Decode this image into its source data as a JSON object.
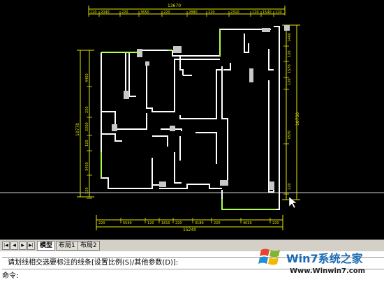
{
  "drawing": {
    "overall_top": "13670",
    "top_dims": [
      "120",
      "2040",
      "220",
      "3650",
      "220",
      "2880",
      "220",
      "2310",
      "120",
      "1540",
      "120"
    ],
    "bottom_dims": [
      "220",
      "5540",
      "120",
      "1810",
      "220",
      "3180",
      "220",
      "4020",
      "220"
    ],
    "overall_bottom": "15240",
    "left_overall": "10770",
    "left_dims": [
      "4450",
      "220",
      "2260",
      "120",
      "3450",
      "120"
    ],
    "right_dims": [
      "1460",
      "120",
      "1570",
      "120",
      "7870",
      "220"
    ],
    "right_overall": "10750",
    "colors": {
      "dims": "#e6e600",
      "walls": "#ffffff",
      "green_wall": "#b0ff50",
      "canvas": "#000000"
    }
  },
  "tabs": {
    "nav": [
      "|◀",
      "◀",
      "▶",
      "▶|"
    ],
    "model": "模型",
    "layout1": "布局1",
    "layout2": "布局2"
  },
  "command": {
    "prompt": "请划线相交选要标注的线条[设置比例(S)/其他参数(D)]:",
    "label": "命令:"
  },
  "watermark": {
    "title": "Win7系统之家",
    "url": "Www.Winwin7.com"
  }
}
